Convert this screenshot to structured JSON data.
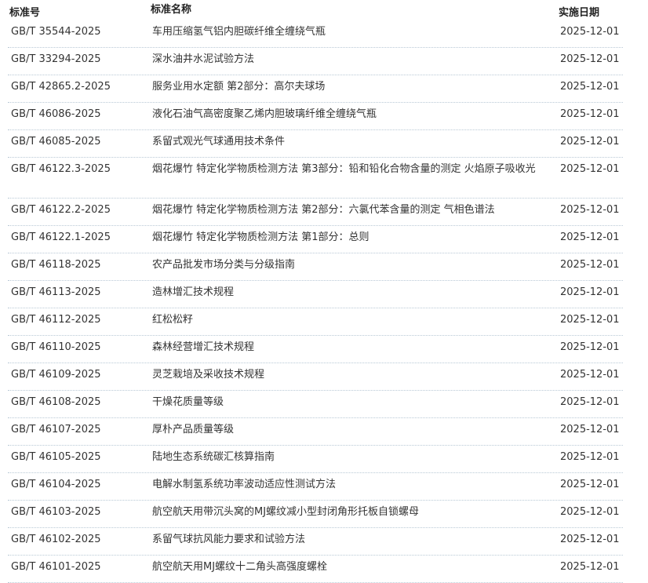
{
  "headers": {
    "code": "标准号",
    "name": "标准名称",
    "date": "实施日期"
  },
  "rows": [
    {
      "code": "GB/T 35544-2025",
      "name": "车用压缩氢气铝内胆碳纤维全缠绕气瓶",
      "date": "2025-12-01"
    },
    {
      "code": "GB/T 33294-2025",
      "name": "深水油井水泥试验方法",
      "date": "2025-12-01"
    },
    {
      "code": "GB/T 42865.2-2025",
      "name": "服务业用水定额 第2部分：高尔夫球场",
      "date": "2025-12-01"
    },
    {
      "code": "GB/T 46086-2025",
      "name": "液化石油气高密度聚乙烯内胆玻璃纤维全缠绕气瓶",
      "date": "2025-12-01"
    },
    {
      "code": "GB/T 46085-2025",
      "name": "系留式观光气球通用技术条件",
      "date": "2025-12-01"
    },
    {
      "code": "GB/T 46122.3-2025",
      "name": "烟花爆竹 特定化学物质检测方法 第3部分：铅和铅化合物含量的测定 火焰原子吸收光",
      "date": "2025-12-01"
    },
    {
      "code": "GB/T 46122.2-2025",
      "name": "烟花爆竹 特定化学物质检测方法 第2部分：六氯代苯含量的测定 气相色谱法",
      "date": "2025-12-01"
    },
    {
      "code": "GB/T 46122.1-2025",
      "name": "烟花爆竹 特定化学物质检测方法 第1部分：总则",
      "date": "2025-12-01"
    },
    {
      "code": "GB/T 46118-2025",
      "name": "农产品批发市场分类与分级指南",
      "date": "2025-12-01"
    },
    {
      "code": "GB/T 46113-2025",
      "name": "造林增汇技术规程",
      "date": "2025-12-01"
    },
    {
      "code": "GB/T 46112-2025",
      "name": "红松松籽",
      "date": "2025-12-01"
    },
    {
      "code": "GB/T 46110-2025",
      "name": "森林经营增汇技术规程",
      "date": "2025-12-01"
    },
    {
      "code": "GB/T 46109-2025",
      "name": "灵芝栽培及采收技术规程",
      "date": "2025-12-01"
    },
    {
      "code": "GB/T 46108-2025",
      "name": "干燥花质量等级",
      "date": "2025-12-01"
    },
    {
      "code": "GB/T 46107-2025",
      "name": "厚朴产品质量等级",
      "date": "2025-12-01"
    },
    {
      "code": "GB/T 46105-2025",
      "name": "陆地生态系统碳汇核算指南",
      "date": "2025-12-01"
    },
    {
      "code": "GB/T 46104-2025",
      "name": "电解水制氢系统功率波动适应性测试方法",
      "date": "2025-12-01"
    },
    {
      "code": "GB/T 46103-2025",
      "name": "航空航天用带沉头窝的MJ螺纹减小型封闭角形托板自锁螺母",
      "date": "2025-12-01"
    },
    {
      "code": "GB/T 46102-2025",
      "name": "系留气球抗风能力要求和试验方法",
      "date": "2025-12-01"
    },
    {
      "code": "GB/T 46101-2025",
      "name": "航空航天用MJ螺纹十二角头高强度螺栓",
      "date": "2025-12-01"
    }
  ]
}
